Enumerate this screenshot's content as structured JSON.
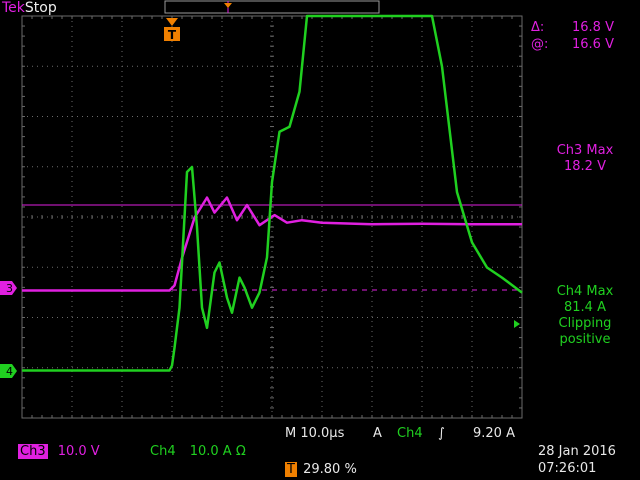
{
  "header": {
    "brand": "Tek",
    "run_state": "Stop"
  },
  "cursor_readout": {
    "delta_label": "Δ:",
    "delta_value": "16.8 V",
    "at_label": "@:",
    "at_value": "16.6 V"
  },
  "measurements": {
    "ch3_max_label": "Ch3 Max",
    "ch3_max_value": "18.2 V",
    "ch4_max_label": "Ch4 Max",
    "ch4_max_value": "81.4 A",
    "ch4_clipping_1": "Clipping",
    "ch4_clipping_2": "positive"
  },
  "channels": {
    "ch3_label": "Ch3",
    "ch3_scale": "10.0 V",
    "ch4_label": "Ch4",
    "ch4_scale": "10.0 A Ω"
  },
  "markers": {
    "ch3_ground": "3",
    "ch4_ground": "4",
    "trigger": "T"
  },
  "timebase": {
    "label": "M",
    "value": "10.0µs",
    "trigger_mode": "A",
    "trigger_source": "Ch4",
    "trigger_slope": "∫",
    "trigger_level": "9.20 A",
    "trigger_position": "29.80 %"
  },
  "datetime": {
    "date": "28 Jan  2016",
    "time": "07:26:01"
  },
  "colors": {
    "ch3": "#e020e0",
    "ch4": "#20d020",
    "trigger": "#f08000",
    "grid": "#6a6a6a"
  },
  "chart_data": {
    "type": "line",
    "x_divisions": 10,
    "y_divisions": 8,
    "x_unit": "µs",
    "x_per_div": 10,
    "series": [
      {
        "name": "Ch3",
        "unit": "V",
        "points": [
          [
            0,
            -0.05
          ],
          [
            2.95,
            -0.05
          ],
          [
            3.05,
            0.05
          ],
          [
            3.2,
            0.6
          ],
          [
            3.45,
            1.4
          ],
          [
            3.7,
            1.8
          ],
          [
            3.85,
            1.5
          ],
          [
            4.1,
            1.8
          ],
          [
            4.3,
            1.35
          ],
          [
            4.5,
            1.65
          ],
          [
            4.75,
            1.25
          ],
          [
            5.05,
            1.45
          ],
          [
            5.3,
            1.3
          ],
          [
            5.6,
            1.35
          ],
          [
            6.0,
            1.3
          ],
          [
            7.0,
            1.27
          ],
          [
            8.0,
            1.28
          ],
          [
            9.0,
            1.27
          ],
          [
            10.0,
            1.27
          ]
        ]
      },
      {
        "name": "Ch4",
        "unit": "A",
        "points": [
          [
            0,
            -0.05
          ],
          [
            2.95,
            -0.05
          ],
          [
            3.0,
            0.05
          ],
          [
            3.05,
            0.4
          ],
          [
            3.15,
            1.2
          ],
          [
            3.3,
            3.9
          ],
          [
            3.4,
            4.0
          ],
          [
            3.5,
            2.8
          ],
          [
            3.6,
            1.2
          ],
          [
            3.7,
            0.8
          ],
          [
            3.85,
            1.9
          ],
          [
            3.95,
            2.1
          ],
          [
            4.1,
            1.4
          ],
          [
            4.2,
            1.1
          ],
          [
            4.35,
            1.8
          ],
          [
            4.45,
            1.6
          ],
          [
            4.6,
            1.2
          ],
          [
            4.75,
            1.5
          ],
          [
            4.9,
            2.2
          ],
          [
            5.0,
            3.7
          ],
          [
            5.15,
            4.7
          ],
          [
            5.35,
            4.8
          ],
          [
            5.55,
            5.5
          ],
          [
            5.7,
            7.5
          ],
          [
            5.8,
            8.0
          ],
          [
            8.2,
            8.0
          ],
          [
            8.4,
            6.0
          ],
          [
            8.7,
            3.5
          ],
          [
            9.0,
            2.5
          ],
          [
            9.3,
            2.0
          ],
          [
            9.6,
            1.8
          ],
          [
            10.0,
            1.5
          ]
        ]
      }
    ]
  }
}
